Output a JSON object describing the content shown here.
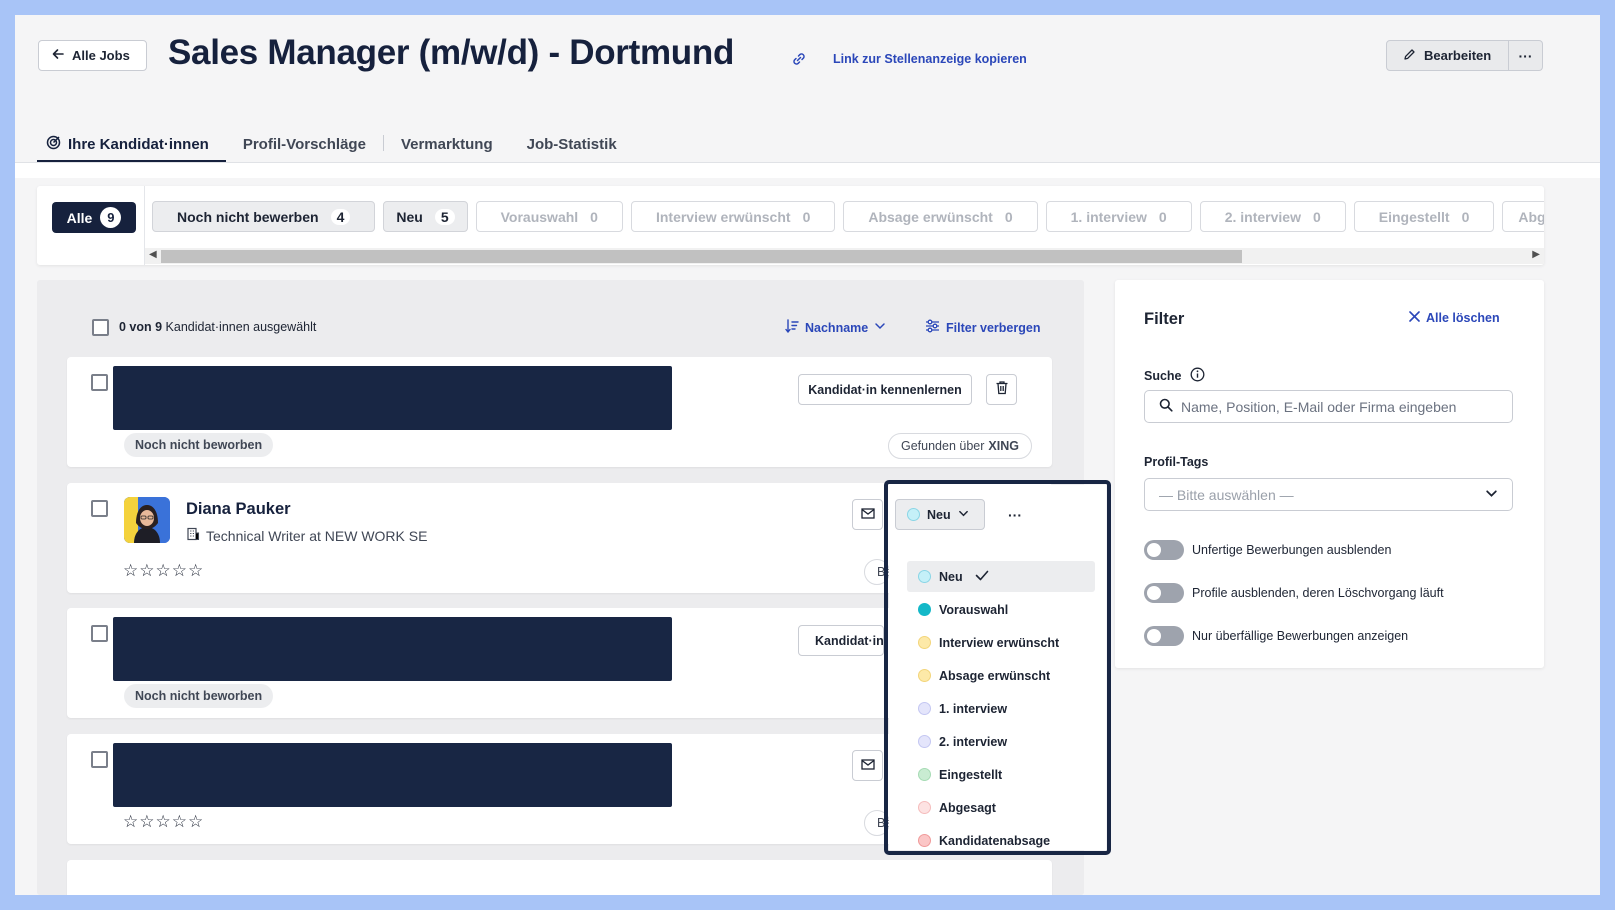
{
  "header": {
    "back_label": "Alle Jobs",
    "title": "Sales Manager (m/w/d) - Dortmund",
    "copy_link_label": "Link zur Stellenanzeige kopieren",
    "edit_label": "Bearbeiten",
    "more_label": "···"
  },
  "tabs": [
    {
      "label": "Ihre Kandidat·innen"
    },
    {
      "label": "Profil-Vorschläge"
    },
    {
      "label": "Vermarktung"
    },
    {
      "label": "Job-Statistik"
    }
  ],
  "status_filter": {
    "all": {
      "label": "Alle",
      "count": "9"
    },
    "chips": [
      {
        "label": "Noch nicht bewerben",
        "count": "4"
      },
      {
        "label": "Neu",
        "count": "5"
      },
      {
        "label": "Vorauswahl",
        "count": "0"
      },
      {
        "label": "Interview erwünscht",
        "count": "0"
      },
      {
        "label": "Absage erwünscht",
        "count": "0"
      },
      {
        "label": "1. interview",
        "count": "0"
      },
      {
        "label": "2. interview",
        "count": "0"
      },
      {
        "label": "Eingestellt",
        "count": "0"
      },
      {
        "label": "Abge",
        "count": ""
      }
    ]
  },
  "list": {
    "selected_count": "0 von 9",
    "selected_suffix": " Kandidat·innen ausgewählt",
    "sort_label": "Nachname",
    "filter_toggle_label": "Filter verbergen"
  },
  "cards": {
    "c1": {
      "status": "Noch nicht beworben",
      "action": "Kandidat·in kennenlernen",
      "source_prefix": "Gefunden über",
      "source": "XING"
    },
    "c2": {
      "name": "Diana Pauker",
      "position": "Technical Writer at NEW WORK SE",
      "stars": "☆☆☆☆☆",
      "status_button": "Neu",
      "source_stub": "Bew"
    },
    "c3": {
      "status": "Noch nicht beworben",
      "action": "Kandidat·in ke"
    },
    "c4": {
      "stars": "☆☆☆☆☆",
      "source_stub": "Bew"
    }
  },
  "status_menu": {
    "items": [
      {
        "label": "Neu",
        "color": "#c5f0f8",
        "border": "#8ad6e6",
        "selected": true
      },
      {
        "label": "Vorauswahl",
        "color": "#14b8c8",
        "border": "#14b8c8"
      },
      {
        "label": "Interview erwünscht",
        "color": "#fde9a8",
        "border": "#f3d57a"
      },
      {
        "label": "Absage erwünscht",
        "color": "#fde9a8",
        "border": "#f3d57a"
      },
      {
        "label": "1. interview",
        "color": "#e4e5fb",
        "border": "#c4c7f2"
      },
      {
        "label": "2. interview",
        "color": "#e4e5fb",
        "border": "#c4c7f2"
      },
      {
        "label": "Eingestellt",
        "color": "#c9ecd2",
        "border": "#a6dbb4"
      },
      {
        "label": "Abgesagt",
        "color": "#fde2e2",
        "border": "#f5bcbc"
      },
      {
        "label": "Kandidatenabsage",
        "color": "#fbc6c6",
        "border": "#f09a9a"
      }
    ]
  },
  "filter": {
    "title": "Filter",
    "clear_label": "Alle löschen",
    "search_label": "Suche",
    "search_placeholder": "Name, Position, E-Mail oder Firma eingeben",
    "tags_label": "Profil-Tags",
    "tags_placeholder": "— Bitte auswählen —",
    "toggles": [
      {
        "label": "Unfertige Bewerbungen ausblenden"
      },
      {
        "label": "Profile ausblenden, deren Löschvorgang läuft"
      },
      {
        "label": "Nur überfällige Bewerbungen anzeigen"
      }
    ]
  },
  "colors": {
    "brand_dark": "#16213d",
    "link": "#2b47b9"
  }
}
